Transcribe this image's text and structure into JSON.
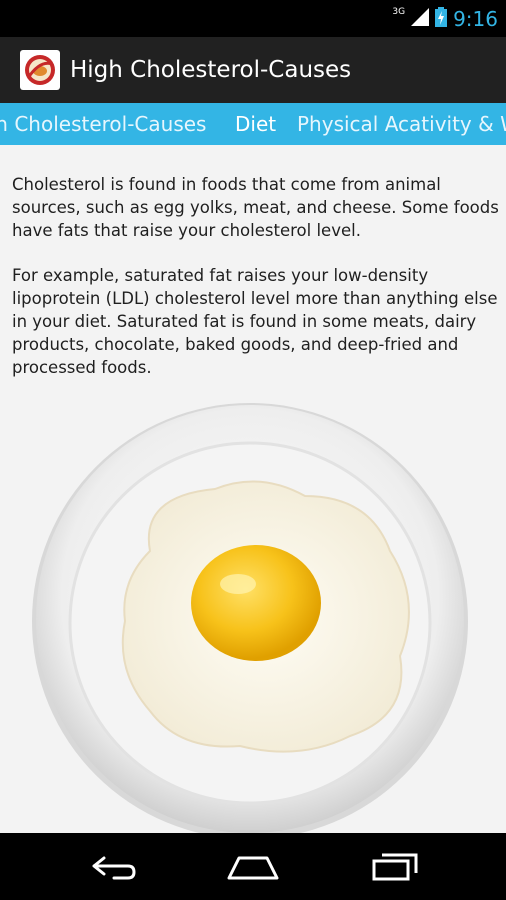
{
  "status_bar": {
    "network": "3G",
    "time": "9:16"
  },
  "action_bar": {
    "title": "High Cholesterol-Causes",
    "icon": "app-logo-icon"
  },
  "tabs": [
    {
      "label": "High Cholesterol-Causes",
      "active": false
    },
    {
      "label": "Diet",
      "active": true
    },
    {
      "label": "Physical Acativity & Weight",
      "active": false
    }
  ],
  "content": {
    "paragraph_1": "Cholesterol is found in foods that come from animal sources, such as egg yolks, meat, and cheese. Some foods have fats that raise your cholesterol level.",
    "paragraph_2": "For example, saturated fat raises your low-density lipoprotein (LDL) cholesterol level more than anything else in your diet. Saturated fat is found in some meats, dairy products, chocolate, baked goods, and deep-fried and processed foods."
  },
  "nav_bar": {
    "back": "back-icon",
    "home": "home-icon",
    "recents": "recent-apps-icon"
  },
  "colors": {
    "accent": "#33b5e5",
    "action_bar": "#212121",
    "background": "#f3f3f3"
  }
}
